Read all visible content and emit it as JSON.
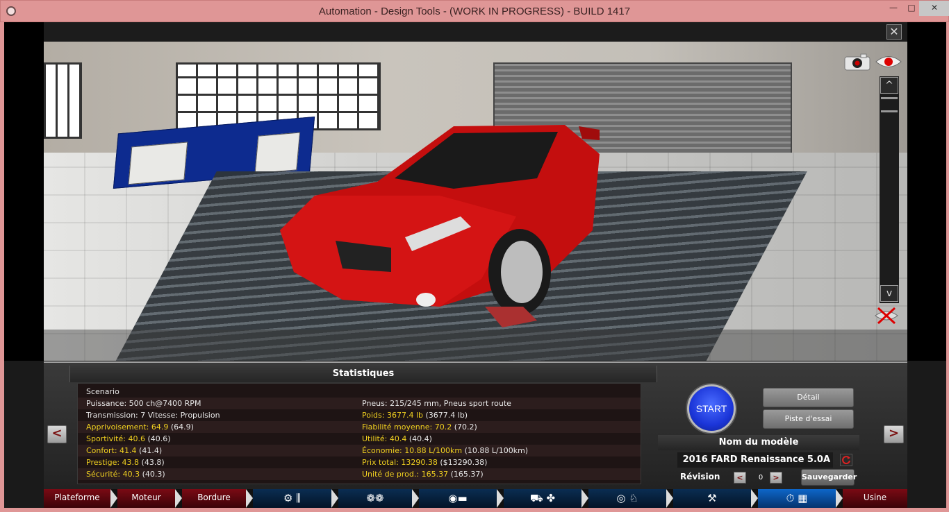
{
  "window": {
    "title": "Automation - Design Tools - (WORK IN PROGRESS) - BUILD 1417",
    "minimize_glyph": "—",
    "maximize_glyph": "□",
    "close_glyph": "✕"
  },
  "viewport": {
    "close_glyph": "✕",
    "zoom_up_glyph": "^",
    "zoom_down_glyph": "v"
  },
  "stats": {
    "header": "Statistiques",
    "left": [
      {
        "label": "Scenario",
        "value": "",
        "extra": ""
      },
      {
        "label": "Puissance: 500 ch@7400 RPM",
        "value": "",
        "extra": ""
      },
      {
        "label": "Transmission: 7 Vitesse: Propulsion",
        "value": "",
        "extra": ""
      },
      {
        "label": "Apprivoisement:",
        "value": "64.9",
        "extra": "(64.9)"
      },
      {
        "label": "Sportivité:",
        "value": "40.6",
        "extra": "(40.6)"
      },
      {
        "label": "Confort:",
        "value": "41.4",
        "extra": "(41.4)"
      },
      {
        "label": "Prestige:",
        "value": "43.8",
        "extra": "(43.8)"
      },
      {
        "label": "Sécurité:",
        "value": "40.3",
        "extra": "(40.3)"
      }
    ],
    "right": [
      {
        "label": "",
        "value": "",
        "extra": ""
      },
      {
        "label": "Pneus: 215/245 mm, Pneus sport route",
        "value": "",
        "extra": ""
      },
      {
        "label": "Poids:",
        "value": "3677.4 lb",
        "extra": "(3677.4 lb)"
      },
      {
        "label": "Fiabilité moyenne:",
        "value": "70.2",
        "extra": "(70.2)"
      },
      {
        "label": "Utilité:",
        "value": "40.4",
        "extra": "(40.4)"
      },
      {
        "label": "Économie:",
        "value": "10.88 L/100km",
        "extra": "(10.88 L/100km)"
      },
      {
        "label": "Prix total:",
        "value": "13290.38",
        "extra": "($13290.38)"
      },
      {
        "label": "Unité de prod.:",
        "value": "165.37",
        "extra": "(165.37)"
      }
    ]
  },
  "actions": {
    "start": "START",
    "detail": "Détail",
    "test_track": "Piste d'essai",
    "model_header": "Nom du modèle",
    "model_name": "2016 FARD Renaissance 5.0A",
    "revision_label": "Révision",
    "revision_value": "0",
    "save": "Sauvegarder",
    "prev_glyph": "<",
    "next_glyph": ">"
  },
  "tabs": {
    "plateforme": "Plateforme",
    "moteur": "Moteur",
    "bordure": "Bordure",
    "usine": "Usine"
  },
  "colors": {
    "accent_yellow": "#f0d020",
    "start_blue": "#1b35d8",
    "tab_red": "#7a0a14",
    "tab_blue": "#0a2d52",
    "car_red": "#d01010"
  }
}
